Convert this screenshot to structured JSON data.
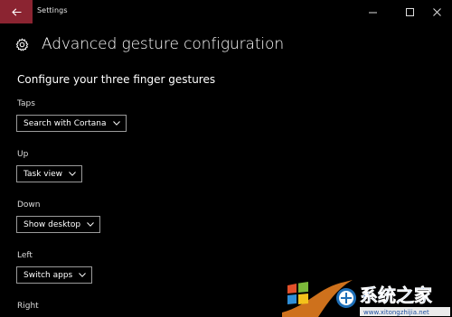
{
  "window": {
    "app_title": "Settings"
  },
  "header": {
    "page_title": "Advanced gesture configuration",
    "icon": "gear-icon"
  },
  "section": {
    "title": "Configure your three finger gestures"
  },
  "gestures": [
    {
      "label": "Taps",
      "value": "Search with Cortana"
    },
    {
      "label": "Up",
      "value": "Task view"
    },
    {
      "label": "Down",
      "value": "Show desktop"
    },
    {
      "label": "Left",
      "value": "Switch apps"
    },
    {
      "label": "Right",
      "value": ""
    }
  ],
  "watermark": {
    "site_name": "系统之家",
    "url": "www.xitongzhijia.net"
  },
  "colors": {
    "back_button": "#8b2431",
    "background": "#000000",
    "dropdown_border": "#9a9a9a"
  }
}
